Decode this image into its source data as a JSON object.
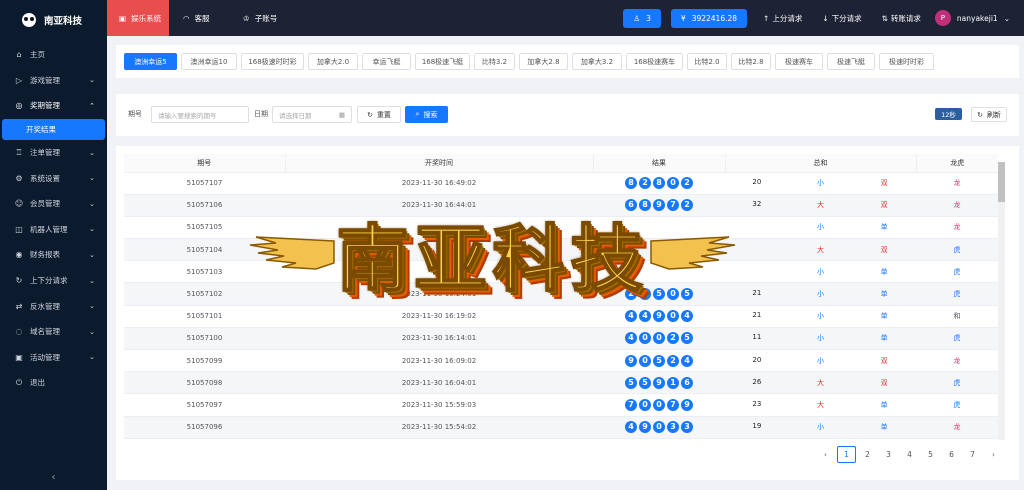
{
  "brand": {
    "name": "南亚科技"
  },
  "topbar": {
    "nav": [
      {
        "label": "娱乐系统",
        "icon": "gift-icon"
      },
      {
        "label": "客服",
        "icon": "headset-icon"
      },
      {
        "label": "子账号",
        "icon": "team-icon"
      }
    ],
    "online_count": "3",
    "balance": "3922416.28",
    "actions": [
      {
        "label": "上分请求",
        "icon": "arrow-up-icon"
      },
      {
        "label": "下分请求",
        "icon": "arrow-down-icon"
      },
      {
        "label": "转账请求",
        "icon": "transfer-icon"
      }
    ],
    "user": {
      "avatar": "P",
      "name": "nanyakeji1"
    }
  },
  "sidebar": {
    "items": [
      {
        "label": "主页",
        "icon": "home-icon"
      },
      {
        "label": "游戏管理",
        "icon": "game-icon"
      },
      {
        "label": "奖期管理",
        "icon": "award-icon"
      },
      {
        "label": "注单管理",
        "icon": "trophy-icon"
      },
      {
        "label": "系统设置",
        "icon": "settings-icon"
      },
      {
        "label": "会员管理",
        "icon": "user-icon"
      },
      {
        "label": "机器人管理",
        "icon": "robot-icon"
      },
      {
        "label": "财务报表",
        "icon": "money-icon"
      },
      {
        "label": "上下分请求",
        "icon": "updown-icon"
      },
      {
        "label": "反水管理",
        "icon": "rebate-icon"
      },
      {
        "label": "域名管理",
        "icon": "domain-icon"
      },
      {
        "label": "活动管理",
        "icon": "event-icon"
      },
      {
        "label": "退出",
        "icon": "logout-icon"
      }
    ],
    "active_sub": "开奖结果"
  },
  "lottery_tabs": [
    "澳洲幸运5",
    "澳洲幸运10",
    "168极速时时彩",
    "加拿大2.0",
    "幸运飞艇",
    "168极速飞艇",
    "比特3.2",
    "加拿大2.8",
    "加拿大3.2",
    "168极速赛车",
    "比特2.0",
    "比特2.8",
    "极速赛车",
    "极速飞艇",
    "极速时时彩"
  ],
  "filter": {
    "period_label": "期号",
    "period_placeholder": "请输入要搜索的期号",
    "date_label": "日期",
    "date_placeholder": "请选择日期",
    "reset_label": "重置",
    "search_label": "搜索",
    "countdown": "12秒",
    "refresh_label": "刷新"
  },
  "table": {
    "headers": [
      "期号",
      "开奖时间",
      "结果",
      "总和",
      "龙虎"
    ],
    "rows": [
      {
        "period": "51057107",
        "time": "2023-11-30 16:49:02",
        "balls": [
          "8",
          "2",
          "8",
          "0",
          "2"
        ],
        "sum": "20",
        "size": "小",
        "parity": "双",
        "dt": "龙"
      },
      {
        "period": "51057106",
        "time": "2023-11-30 16:44:01",
        "balls": [
          "6",
          "8",
          "9",
          "7",
          "2"
        ],
        "sum": "32",
        "size": "大",
        "parity": "双",
        "dt": "龙"
      },
      {
        "period": "51057105",
        "time": "",
        "balls": [
          "",
          "",
          "",
          "",
          ""
        ],
        "sum": "",
        "size": "小",
        "parity": "单",
        "dt": "龙"
      },
      {
        "period": "51057104",
        "time": "",
        "balls": [
          "",
          "",
          "",
          "",
          ""
        ],
        "sum": "",
        "size": "大",
        "parity": "双",
        "dt": "虎"
      },
      {
        "period": "51057103",
        "time": "",
        "balls": [
          "",
          "",
          "",
          "",
          ""
        ],
        "sum": "",
        "size": "小",
        "parity": "单",
        "dt": "虎"
      },
      {
        "period": "51057102",
        "time": "2023-11-30 16:24:01",
        "balls": [
          "2",
          "9",
          "5",
          "0",
          "5"
        ],
        "sum": "21",
        "size": "小",
        "parity": "单",
        "dt": "虎"
      },
      {
        "period": "51057101",
        "time": "2023-11-30 16:19:02",
        "balls": [
          "4",
          "4",
          "9",
          "0",
          "4"
        ],
        "sum": "21",
        "size": "小",
        "parity": "单",
        "dt": "和"
      },
      {
        "period": "51057100",
        "time": "2023-11-30 16:14:01",
        "balls": [
          "4",
          "0",
          "0",
          "2",
          "5"
        ],
        "sum": "11",
        "size": "小",
        "parity": "单",
        "dt": "虎"
      },
      {
        "period": "51057099",
        "time": "2023-11-30 16:09:02",
        "balls": [
          "9",
          "0",
          "5",
          "2",
          "4"
        ],
        "sum": "20",
        "size": "小",
        "parity": "双",
        "dt": "龙"
      },
      {
        "period": "51057098",
        "time": "2023-11-30 16:04:01",
        "balls": [
          "5",
          "5",
          "9",
          "1",
          "6"
        ],
        "sum": "26",
        "size": "大",
        "parity": "双",
        "dt": "虎"
      },
      {
        "period": "51057097",
        "time": "2023-11-30 15:59:03",
        "balls": [
          "7",
          "0",
          "0",
          "7",
          "9"
        ],
        "sum": "23",
        "size": "大",
        "parity": "单",
        "dt": "虎"
      },
      {
        "period": "51057096",
        "time": "2023-11-30 15:54:02",
        "balls": [
          "4",
          "9",
          "0",
          "3",
          "3"
        ],
        "sum": "19",
        "size": "小",
        "parity": "单",
        "dt": "龙"
      }
    ]
  },
  "pagination": {
    "prev": "‹",
    "pages": [
      "1",
      "2",
      "3",
      "4",
      "5",
      "6",
      "7"
    ],
    "next": "›"
  },
  "watermark": {
    "text": "南亚科技"
  },
  "colors": {
    "accent": "#1677ff",
    "sidebar_bg": "#0c1a2d",
    "topbar_bg": "#1e2235",
    "active_nav": "#e94e4e"
  }
}
